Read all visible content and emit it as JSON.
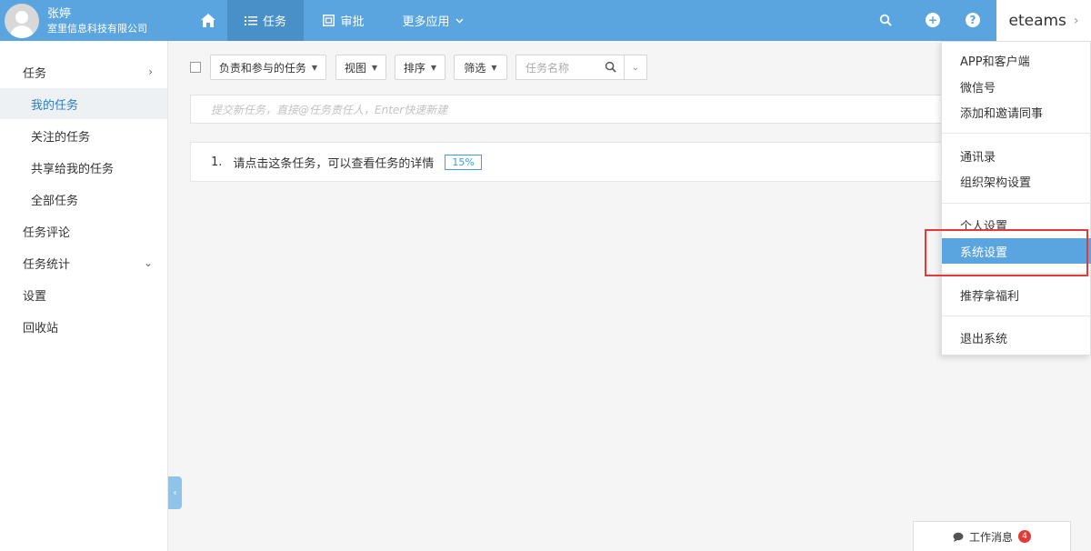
{
  "user": {
    "name": "张婷",
    "org": "室里信息科技有限公司"
  },
  "topnav": {
    "task_label": "任务",
    "approve_label": "审批",
    "more_label": "更多应用",
    "brand": "eteams",
    "accent": "#5aa5df"
  },
  "sidebar": {
    "items": [
      {
        "label": "任务",
        "level": "top",
        "arrow": "right"
      },
      {
        "label": "我的任务",
        "level": "sub",
        "active": true
      },
      {
        "label": "关注的任务",
        "level": "sub"
      },
      {
        "label": "共享给我的任务",
        "level": "sub"
      },
      {
        "label": "全部任务",
        "level": "sub"
      },
      {
        "label": "任务评论",
        "level": "top"
      },
      {
        "label": "任务统计",
        "level": "top",
        "arrow": "down"
      },
      {
        "label": "设置",
        "level": "top"
      },
      {
        "label": "回收站",
        "level": "top"
      }
    ]
  },
  "toolbar": {
    "filter_scope": "负责和参与的任务",
    "view": "视图",
    "sort": "排序",
    "filter": "筛选",
    "search_placeholder": "任务名称"
  },
  "quick_add": {
    "placeholder": "提交新任务，直接@任务责任人，Enter快速新建"
  },
  "tasks": [
    {
      "index": "1.",
      "title": "请点击这条任务，可以查看任务的详情",
      "progress": "15%"
    }
  ],
  "dropdown": {
    "groups": [
      [
        "APP和客户端",
        "微信号",
        "添加和邀请同事"
      ],
      [
        "通讯录",
        "组织架构设置"
      ],
      [
        "个人设置",
        "系统设置"
      ],
      [
        "推荐拿福利"
      ],
      [
        "退出系统"
      ]
    ],
    "highlighted": "系统设置"
  },
  "messages": {
    "label": "工作消息",
    "count": "4"
  }
}
